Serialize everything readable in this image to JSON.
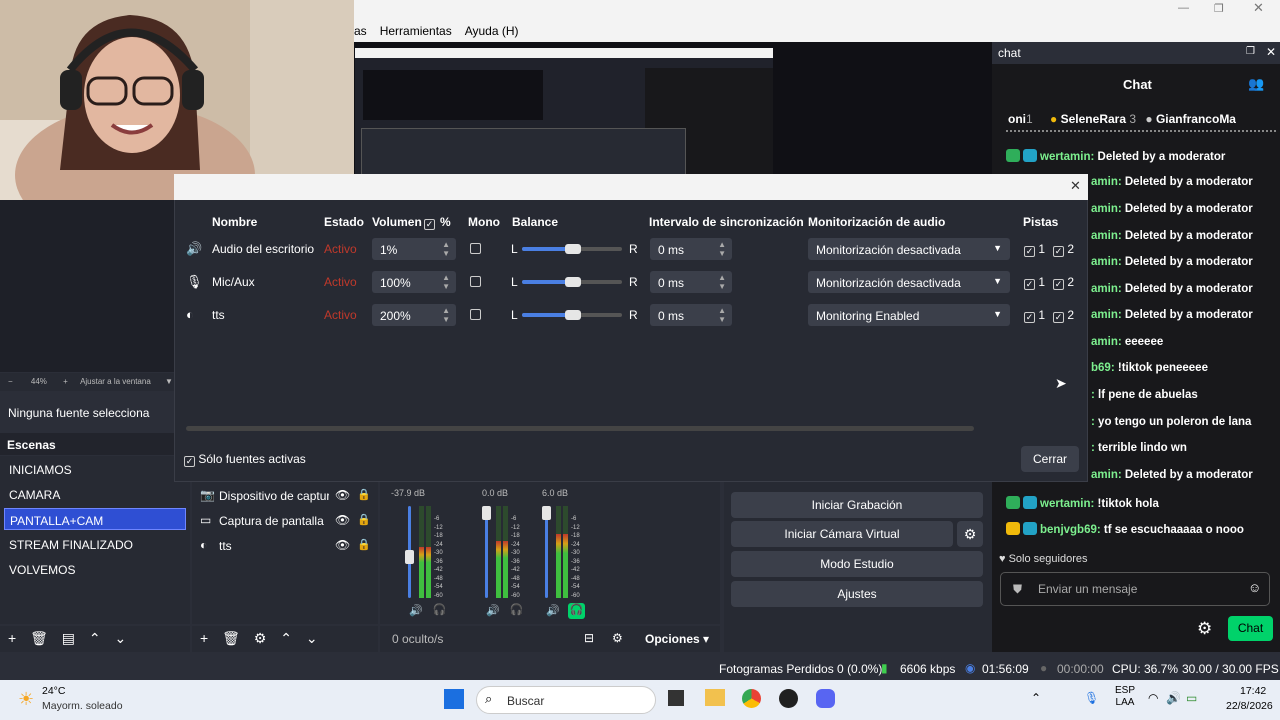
{
  "menu": {
    "items": [
      "as",
      "Herramientas",
      "Ayuda (H)"
    ]
  },
  "chat": {
    "panel_title": "chat",
    "header": "Chat",
    "top_users": [
      {
        "name": "oni",
        "count": "1"
      },
      {
        "name": "SeleneRara",
        "count": "3"
      },
      {
        "name": "GianfrancoMa",
        "count": ""
      }
    ],
    "messages": [
      {
        "user": "wertamin:",
        "text": "Deleted by a moderator"
      },
      {
        "user": "amin:",
        "text": "Deleted by a moderator"
      },
      {
        "user": "amin:",
        "text": "Deleted by a moderator"
      },
      {
        "user": "amin:",
        "text": "Deleted by a moderator"
      },
      {
        "user": "amin:",
        "text": "Deleted by a moderator"
      },
      {
        "user": "amin:",
        "text": "Deleted by a moderator"
      },
      {
        "user": "amin:",
        "text": "Deleted by a moderator"
      },
      {
        "user": "amin:",
        "text": "eeeeee"
      },
      {
        "user": "b69:",
        "text": "!tiktok peneeeee"
      },
      {
        "user": ":",
        "text": "lf pene de abuelas"
      },
      {
        "user": ":",
        "text": "yo tengo un poleron de lana"
      },
      {
        "user": ":",
        "text": "terrible lindo wn"
      },
      {
        "user": "amin:",
        "text": "Deleted by a moderator"
      },
      {
        "user": "wertamin:",
        "text": "!tiktok hola"
      },
      {
        "user": "benjvgb69:",
        "text": "tf se escuchaaaaa o nooo"
      }
    ],
    "followers_only": "Solo seguidores",
    "input_placeholder": "Enviar un mensaje",
    "send_label": "Chat"
  },
  "dialog": {
    "headers": {
      "name": "Nombre",
      "state": "Estado",
      "volume": "Volumen",
      "percent": "%",
      "mono": "Mono",
      "balance": "Balance",
      "sync": "Intervalo de sincronización",
      "monitor": "Monitorización de audio",
      "tracks": "Pistas"
    },
    "rows": [
      {
        "name": "Audio del escritorio",
        "state": "Activo",
        "volume": "1%",
        "sync": "0 ms",
        "monitor": "Monitorización desactivada",
        "t1": "1",
        "t2": "2",
        "balance": 0.5
      },
      {
        "name": "Mic/Aux",
        "state": "Activo",
        "volume": "100%",
        "sync": "0 ms",
        "monitor": "Monitorización desactivada",
        "t1": "1",
        "t2": "2",
        "balance": 0.5
      },
      {
        "name": "tts",
        "state": "Activo",
        "volume": "200%",
        "sync": "0 ms",
        "monitor": "Monitoring Enabled",
        "t1": "1",
        "t2": "2",
        "balance": 0.5
      }
    ],
    "balance_l": "L",
    "balance_r": "R",
    "only_active": "Sólo fuentes activas",
    "close_label": "Cerrar"
  },
  "left": {
    "zoom": "44%",
    "fit": "Ajustar a la ventana",
    "no_source": "Ninguna fuente selecciona",
    "scenes_title": "Escenas",
    "scenes": [
      "INICIAMOS",
      "CAMARA",
      "PANTALLA+CAM",
      "STREAM FINALIZADO",
      "VOLVEMOS"
    ],
    "active_scene": 2
  },
  "sources": [
    "Dispositivo de captura",
    "Captura de pantalla",
    "tts"
  ],
  "mixer": {
    "levels": [
      "-37.9 dB",
      "0.0 dB",
      "6.0 dB"
    ],
    "hidden": "0 oculto/s",
    "options": "Opciones",
    "scale": [
      "-6",
      "-12",
      "-18",
      "-24",
      "-30",
      "-36",
      "-42",
      "-48",
      "-54",
      "-60"
    ]
  },
  "controls": {
    "record": "Iniciar Grabación",
    "vcam": "Iniciar Cámara Virtual",
    "studio": "Modo Estudio",
    "settings": "Ajustes"
  },
  "status": {
    "dropped": "Fotogramas Perdidos 0 (0.0%)",
    "kbps": "6606 kbps",
    "live": "01:56:09",
    "rec": "00:00:00",
    "cpu": "CPU: 36.7%",
    "fps": "30.00 / 30.00 FPS"
  },
  "taskbar": {
    "temp": "24°C",
    "weather": "Mayorm. soleado",
    "search": "Buscar",
    "lang1": "ESP",
    "lang2": "LAA",
    "time": "17:42",
    "date": "22/8/2026"
  },
  "colors": {
    "accent_green": "#00d26a",
    "scene_active": "#2f4fd3",
    "state_red": "#c0392b",
    "chat_user": "#7df08f"
  }
}
